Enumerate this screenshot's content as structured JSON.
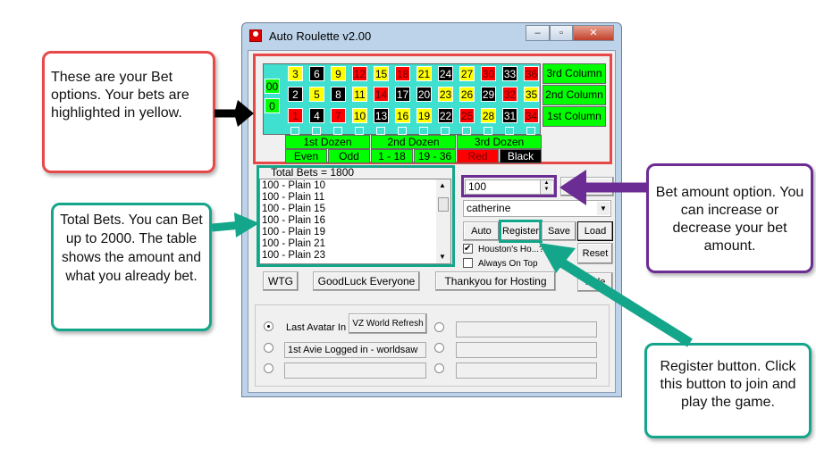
{
  "window": {
    "title": "Auto Roulette v2.00",
    "minimize": "–",
    "maximize": "▫",
    "close": "✕"
  },
  "board": {
    "zeros": [
      "00",
      "0"
    ],
    "rows": [
      [
        3,
        6,
        9,
        12,
        15,
        18,
        21,
        24,
        27,
        30,
        33,
        36
      ],
      [
        2,
        5,
        8,
        11,
        14,
        17,
        20,
        23,
        26,
        29,
        32,
        35
      ],
      [
        1,
        4,
        7,
        10,
        13,
        16,
        19,
        22,
        25,
        28,
        31,
        34
      ]
    ],
    "highlighted": [
      3,
      9,
      15,
      21,
      27,
      5,
      11,
      23,
      26,
      35,
      10,
      16,
      19,
      28
    ],
    "red_numbers": [
      1,
      3,
      5,
      7,
      9,
      12,
      14,
      16,
      18,
      19,
      21,
      23,
      25,
      27,
      30,
      32,
      34,
      36
    ],
    "columns": [
      "3rd Column",
      "2nd Column",
      "1st Column"
    ],
    "dozens": [
      "1st Dozen",
      "2nd  Dozen",
      "3rd Dozen"
    ],
    "outside": [
      "Even",
      "Odd",
      "1 - 18",
      "19 - 36",
      "Red",
      "Black"
    ],
    "colors": {
      "teal": "#40e0d0",
      "green": "#00ff00",
      "yellow": "#ffff00",
      "red": "#ff0000",
      "black": "#000000"
    }
  },
  "bets": {
    "total_label": "Total Bets = 1800",
    "items": [
      "100 - Plain 10",
      "100 - Plain 11",
      "100 - Plain 15",
      "100 - Plain 16",
      "100 - Plain 19",
      "100 - Plain 21",
      "100 - Plain 23"
    ]
  },
  "controls": {
    "amount": "100",
    "player": "catherine",
    "auto": "Auto",
    "register": "Register",
    "save": "Save",
    "load": "Load",
    "reset": "Reset",
    "hide": "Hide",
    "houstons_label": "Houston's Ho...?",
    "houstons_checked": true,
    "always_on_top": "Always On Top",
    "always_on_top_checked": false,
    "wtg": "WTG",
    "goodluck": "GoodLuck Everyone",
    "thankyou": "Thankyou for Hosting"
  },
  "group": {
    "last_avatar": "Last Avatar In",
    "refresh": "VZ World Refresh",
    "first_avie": "1st Avie Logged in - worldsaw"
  },
  "callouts": {
    "bet_options": "These are your Bet options. Your bets are highlighted in yellow.",
    "total_bets": "Total Bets. You can Bet up to 2000. The table shows the amount and what you already bet.",
    "bet_amount": "Bet amount option. You can increase or decrease your bet amount.",
    "register": "Register button. Click this button to join and play the game.",
    "colors": {
      "red": "#e94848",
      "teal": "#14a68a",
      "purple": "#6b2c93"
    }
  }
}
